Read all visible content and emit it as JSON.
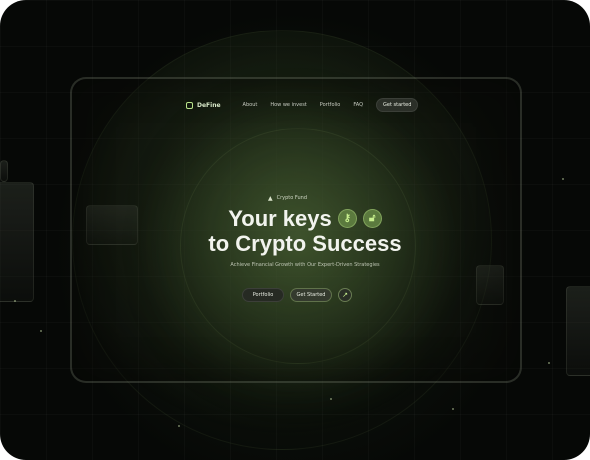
{
  "nav": {
    "brand": "DeFine",
    "links": [
      "About",
      "How we invest",
      "Portfolio",
      "FAQ"
    ],
    "cta": "Get started"
  },
  "hero": {
    "badge": "Crypto Fund",
    "title_line1": "Your keys",
    "title_line2": "to Crypto Success",
    "subtitle": "Achieve Financial Growth with Our Expert-Driven Strategies",
    "primary_button": "Portfolio",
    "secondary_button": "Get Started"
  },
  "icons": {
    "brand": "logo-square-icon",
    "badge": "triangle-icon",
    "key": "key-icon",
    "lock": "unlock-icon",
    "arrow": "arrow-up-right-icon"
  },
  "colors": {
    "background": "#060806",
    "accent": "#b9e38a",
    "orb": "#5b7a3e",
    "text": "#f2f4ee"
  }
}
